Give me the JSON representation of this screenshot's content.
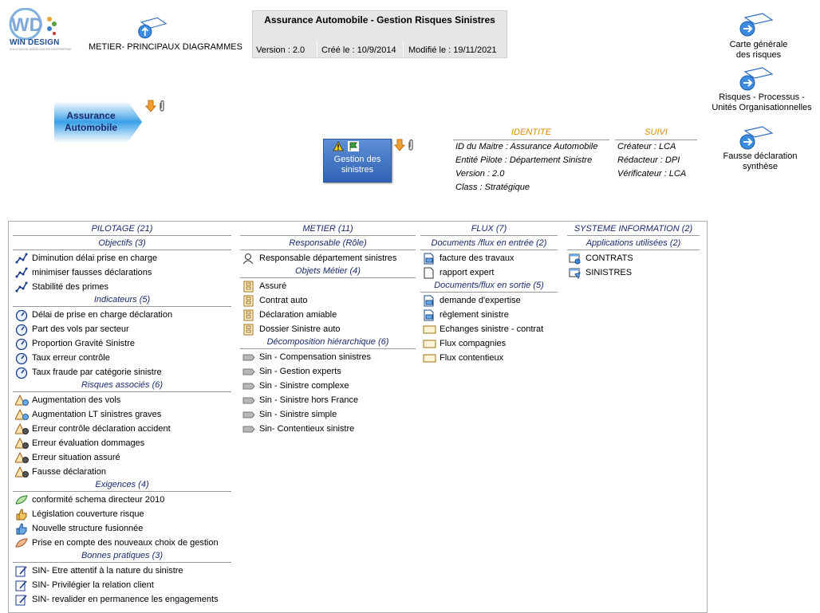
{
  "logo": {
    "brand": "WIN DESIGN",
    "tagline": "SOLUTION DE MODÉLISATION D'ENTREPRISE"
  },
  "header_link": {
    "label": "METIER- PRINCIPAUX DIAGRAMMES"
  },
  "title": {
    "text": "Assurance Automobile - Gestion Risques Sinistres",
    "version": "Version : 2.0",
    "created": "Créé le : 10/9/2014",
    "modified": "Modifié le : 19/11/2021"
  },
  "right_links": [
    {
      "line1": "Carte générale",
      "line2": "des risques"
    },
    {
      "line1": "Risques - Processus -",
      "line2": "Unités Organisationnelles"
    },
    {
      "line1": "Fausse déclaration",
      "line2": "synthèse"
    }
  ],
  "parent_shape": {
    "line1": "Assurance",
    "line2": "Automobile"
  },
  "process": {
    "line1": "Gestion des",
    "line2": "sinistres"
  },
  "identite": {
    "title": "IDENTITE",
    "lines": [
      "ID du Maitre : Assurance Automobile",
      "Entité Pilote : Département Sinistre",
      "Version : 2.0",
      "Class : Stratégique"
    ]
  },
  "suivi": {
    "title": "SUIVI",
    "lines": [
      "Créateur : LCA",
      "Rédacteur : DPI",
      "Vérificateur : LCA"
    ]
  },
  "columns": {
    "pilotage": {
      "title": "PILOTAGE (21)",
      "objectifs": {
        "title": "Objectifs (3)",
        "items": [
          "Diminution délai prise en charge",
          "minimiser fausses déclarations",
          "Stabilité des primes"
        ]
      },
      "indicateurs": {
        "title": "Indicateurs (5)",
        "items": [
          "Délai de prise en charge déclaration",
          "Part des vols par secteur",
          "Proportion Gravité Sinistre",
          "Taux erreur contrôle",
          "Taux fraude par catégorie sinistre"
        ]
      },
      "risques": {
        "title": "Risques associés (6)",
        "items": [
          "Augmentation des vols",
          "Augmentation LT sinistres graves",
          "Erreur contrôle déclaration accident",
          "Erreur évaluation dommages",
          "Erreur situation assuré",
          "Fausse déclaration"
        ]
      },
      "exigences": {
        "title": "Exigences (4)",
        "items": [
          "conformité schema directeur 2010",
          "Législation couverture risque",
          "Nouvelle structure fusionnée",
          "Prise en compte des nouveaux choix de gestion"
        ]
      },
      "bonnes": {
        "title": "Bonnes pratiques (3)",
        "items": [
          "SIN- Etre attentif à la nature du sinistre",
          "SIN- Privilégier la relation client",
          "SIN- revalider en permanence les engagements"
        ]
      }
    },
    "metier": {
      "title": "METIER (11)",
      "responsable": {
        "title": "Responsable (Rôle)",
        "items": [
          "Responsable département sinistres"
        ]
      },
      "objets": {
        "title": "Objets Métier (4)",
        "items": [
          "Assuré",
          "Contrat auto",
          "Déclaration amiable",
          "Dossier Sinistre auto"
        ]
      },
      "decomposition": {
        "title": "Décomposition hiérarchique (6)",
        "items": [
          "Sin - Compensation sinistres",
          "Sin - Gestion experts",
          "Sin - Sinistre complexe",
          "Sin - Sinistre hors France",
          "Sin - Sinistre simple",
          "Sin- Contentieux sinistre"
        ]
      }
    },
    "flux": {
      "title": "FLUX (7)",
      "entree": {
        "title": "Documents /flux en entrée (2)",
        "items": [
          "facture des travaux",
          "rapport expert"
        ]
      },
      "sortie": {
        "title": "Documents/flux en sortie (5)",
        "items": [
          "demande d'expertise",
          "règlement sinistre",
          "Echanges sinistre - contrat",
          "Flux compagnies",
          "Flux contentieux"
        ]
      }
    },
    "si": {
      "title": "SYSTEME INFORMATION (2)",
      "applications": {
        "title": "Applications utilisées (2)",
        "items": [
          "CONTRATS",
          "SINISTRES"
        ]
      }
    }
  }
}
